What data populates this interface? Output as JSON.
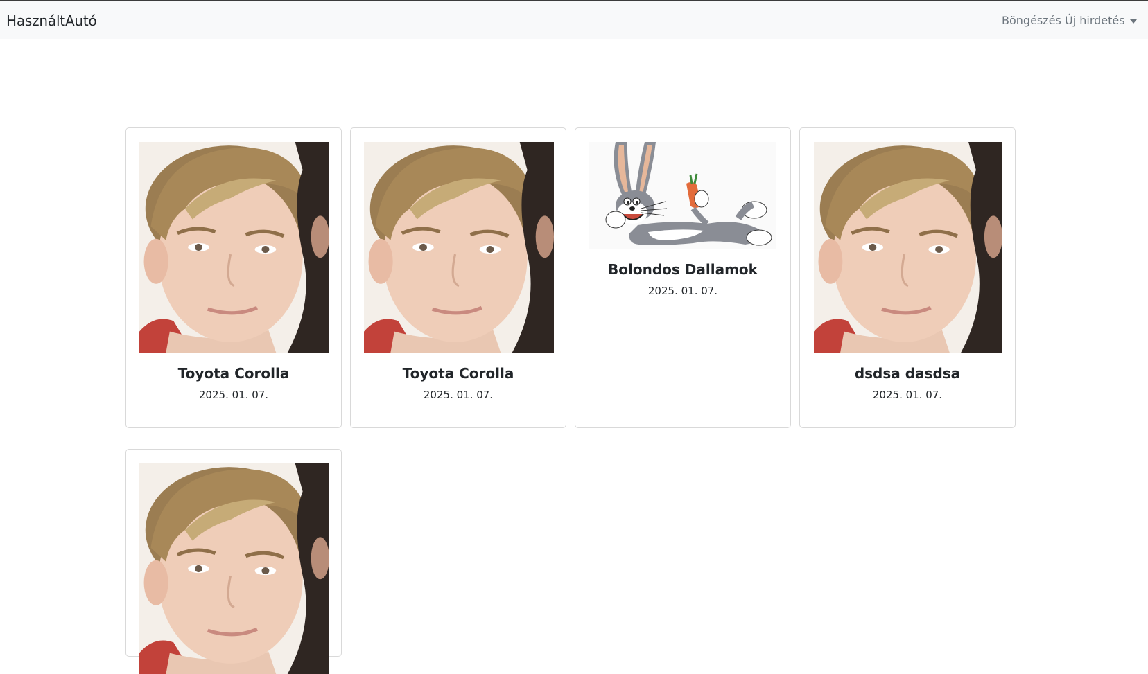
{
  "navbar": {
    "brand": "HasználtAutó",
    "browse": "Böngészés",
    "new_ad": "Új hirdetés",
    "dropdown_icon": "caret-down-icon"
  },
  "listings": [
    {
      "title": "Toyota Corolla",
      "date": "2025. 01. 07.",
      "image": "portrait-photo"
    },
    {
      "title": "Toyota Corolla",
      "date": "2025. 01. 07.",
      "image": "portrait-photo"
    },
    {
      "title": "Bolondos Dallamok",
      "date": "2025. 01. 07.",
      "image": "cartoon-rabbit-image"
    },
    {
      "title": "dsdsa dasdsa",
      "date": "2025. 01. 07.",
      "image": "portrait-photo"
    },
    {
      "title": "",
      "date": "",
      "image": "portrait-photo"
    }
  ],
  "colors": {
    "navbar_bg": "#f8f9fa",
    "link": "#6c757d",
    "text": "#212529",
    "border": "#d9d9d9"
  }
}
